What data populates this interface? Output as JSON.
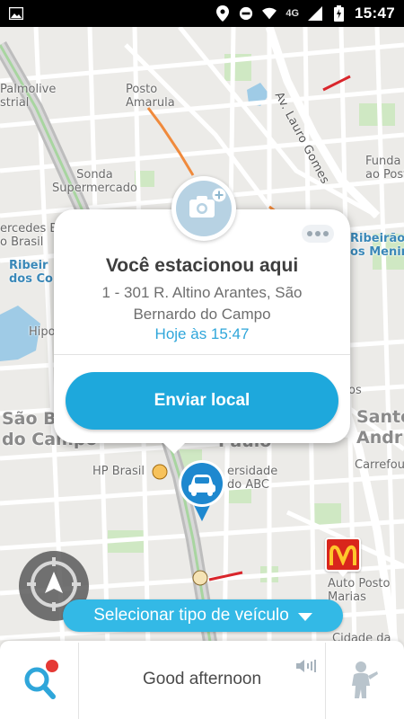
{
  "status_bar": {
    "network": "4G",
    "time": "15:47",
    "icons": [
      "image-icon",
      "location-icon",
      "do-not-disturb-icon",
      "wifi-icon",
      "signal-icon",
      "battery-icon"
    ]
  },
  "map": {
    "labels": [
      {
        "id": "palmolive",
        "text": "Palmolive\nstrial"
      },
      {
        "id": "posto_amarula",
        "text": "Posto\nAmarula"
      },
      {
        "id": "av_lauro_gomes",
        "text": "Av. Lauro Gomes"
      },
      {
        "id": "fundacao",
        "text": "Funda\nao Posto"
      },
      {
        "id": "sonda",
        "text": "Sonda\nSupermercado"
      },
      {
        "id": "mercedes",
        "text": "ercedes B\no Brasil"
      },
      {
        "id": "ribeirao_esq",
        "text": "Ribeir\ndos Co"
      },
      {
        "id": "ribeirao_dir",
        "text": "Ribeirão\nos Menin"
      },
      {
        "id": "hipo",
        "text": "Hipo"
      },
      {
        "id": "os",
        "text": "os"
      },
      {
        "id": "sao_bernardo",
        "text": "São Be\ndo Campo"
      },
      {
        "id": "santo_andre",
        "text": "Santo\nAndr"
      },
      {
        "id": "paulo",
        "text": "Paulo"
      },
      {
        "id": "hp_brasil",
        "text": "HP Brasil"
      },
      {
        "id": "universidade",
        "text": "ersidade\ndo ABC"
      },
      {
        "id": "carrefour",
        "text": "Carrefou"
      },
      {
        "id": "auto_posto",
        "text": "Auto Posto\nMarias"
      },
      {
        "id": "cidade",
        "text": "Cidade da"
      }
    ]
  },
  "parked_card": {
    "title": "Você estacionou aqui",
    "address": "1 - 301 R. Altino Arantes, São Bernardo do Campo",
    "time": "Hoje às 15:47",
    "send_button": "Enviar local"
  },
  "vehicle_selector": {
    "label": "Selecionar tipo de veículo"
  },
  "bottom_bar": {
    "greeting": "Good afternoon"
  },
  "colors": {
    "accent": "#1ea8dc",
    "notification_dot": "#e53935",
    "mcdonalds": "#d9261c"
  }
}
